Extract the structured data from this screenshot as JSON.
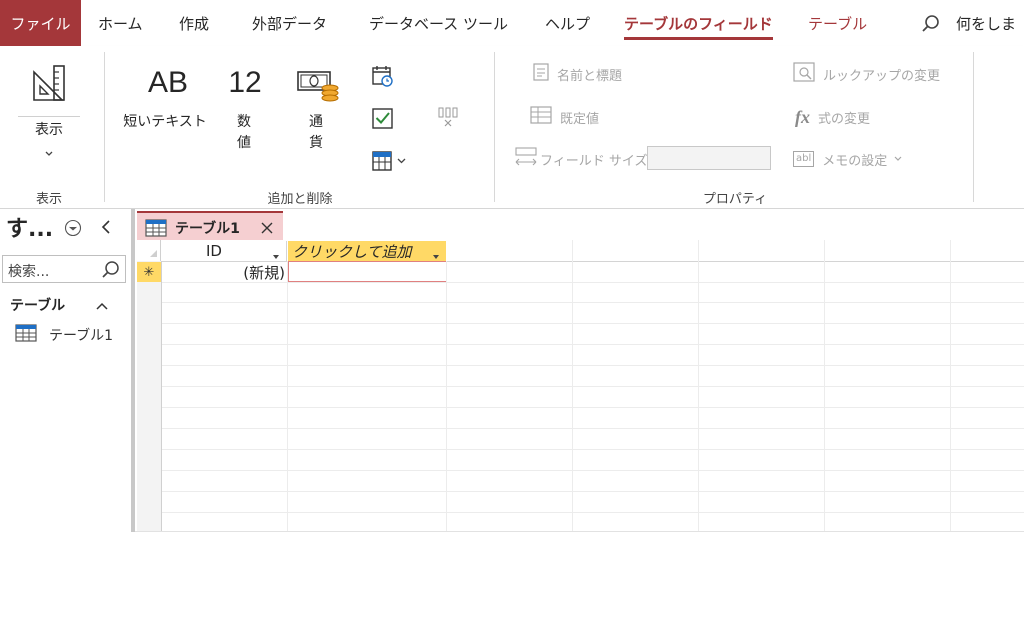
{
  "ribbon_tabs": {
    "file": "ファイル",
    "home": "ホーム",
    "create": "作成",
    "external": "外部データ",
    "dbtools": "データベース ツール",
    "help": "ヘルプ",
    "fields": "テーブルのフィールド",
    "table": "テーブル",
    "tell_me": "何をしま"
  },
  "ribbon": {
    "view": {
      "label": "表示",
      "group": "表示"
    },
    "add_delete": {
      "group": "追加と削除",
      "short_text_glyph": "AB",
      "short_text": "短いテキスト",
      "number_glyph": "12",
      "number_1": "数",
      "number_2": "値",
      "currency_1": "通",
      "currency_2": "貨"
    },
    "properties": {
      "group": "プロパティ",
      "name_caption": "名前と標題",
      "default_value": "既定値",
      "field_size": "フィールド サイズ",
      "field_size_value": "",
      "modify_lookups": "ルックアップの変更",
      "modify_expression": "式の変更",
      "fx_glyph": "fx",
      "memo_settings": "メモの設定",
      "abl_glyph": "abl"
    }
  },
  "nav": {
    "title": "す...",
    "search_placeholder": "検索...",
    "section": "テーブル",
    "items": [
      {
        "label": "テーブル1"
      }
    ]
  },
  "doc": {
    "tab_label": "テーブル1",
    "columns": [
      {
        "label": "ID"
      },
      {
        "label": "クリックして追加"
      }
    ],
    "new_row_marker": "✳",
    "new_row_id": "(新規)"
  },
  "colors": {
    "accent": "#a4373a",
    "tab_bg": "#f5cfd1",
    "add_column": "#ffd966"
  }
}
